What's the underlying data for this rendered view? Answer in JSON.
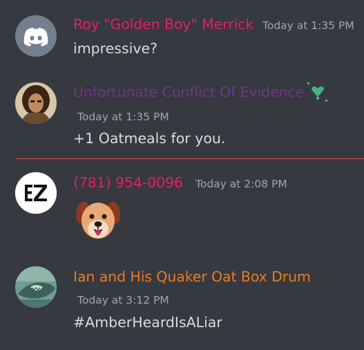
{
  "messages": [
    {
      "author": "Roy \"Golden Boy\" Merrick",
      "timestamp": "Today at 1:35 PM",
      "content": "impressive?",
      "author_color": "#e91e63",
      "avatar": "discord-logo-icon",
      "avatar_bg": "#747f8d"
    },
    {
      "author": "Unfortunate Conflict Of Evidence",
      "timestamp": "Today at 1:35 PM",
      "content": "+1 Oatmeals for you.",
      "author_color": "#71368a",
      "avatar": "portrait-avatar",
      "badge": "sparkle-heart-icon",
      "badge_color": "#43b581"
    },
    {
      "author": "(781) 954-0096",
      "timestamp": "Today at 2:08 PM",
      "content": "dog-face-emoji",
      "author_color": "#e91e63",
      "avatar": "ez-logo-icon"
    },
    {
      "author": "Ian and His Quaker Oat Box Drum",
      "timestamp": "Today at 3:12 PM",
      "content": "#AmberHeardIsALiar",
      "author_color": "#e67e22",
      "avatar": "shark-avatar"
    }
  ],
  "divider_color": "#e1474a"
}
